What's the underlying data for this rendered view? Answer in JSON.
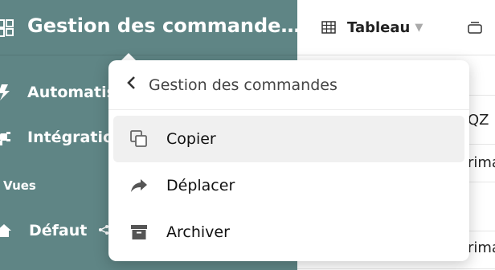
{
  "sidebar": {
    "title": "Gestion des commande…",
    "items": [
      {
        "label": "Automatis"
      },
      {
        "label": "Intégratio"
      }
    ],
    "section_label": "Vues",
    "views": [
      {
        "label": "Défaut"
      }
    ]
  },
  "toolbar": {
    "view_label": "Tableau"
  },
  "grid": {
    "cells": [
      "QZ",
      "rima",
      "rima"
    ]
  },
  "menu": {
    "back_label": "Gestion des commandes",
    "items": [
      {
        "label": "Copier",
        "icon": "copy-icon"
      },
      {
        "label": "Déplacer",
        "icon": "share-arrow-icon"
      },
      {
        "label": "Archiver",
        "icon": "archive-icon"
      }
    ]
  }
}
